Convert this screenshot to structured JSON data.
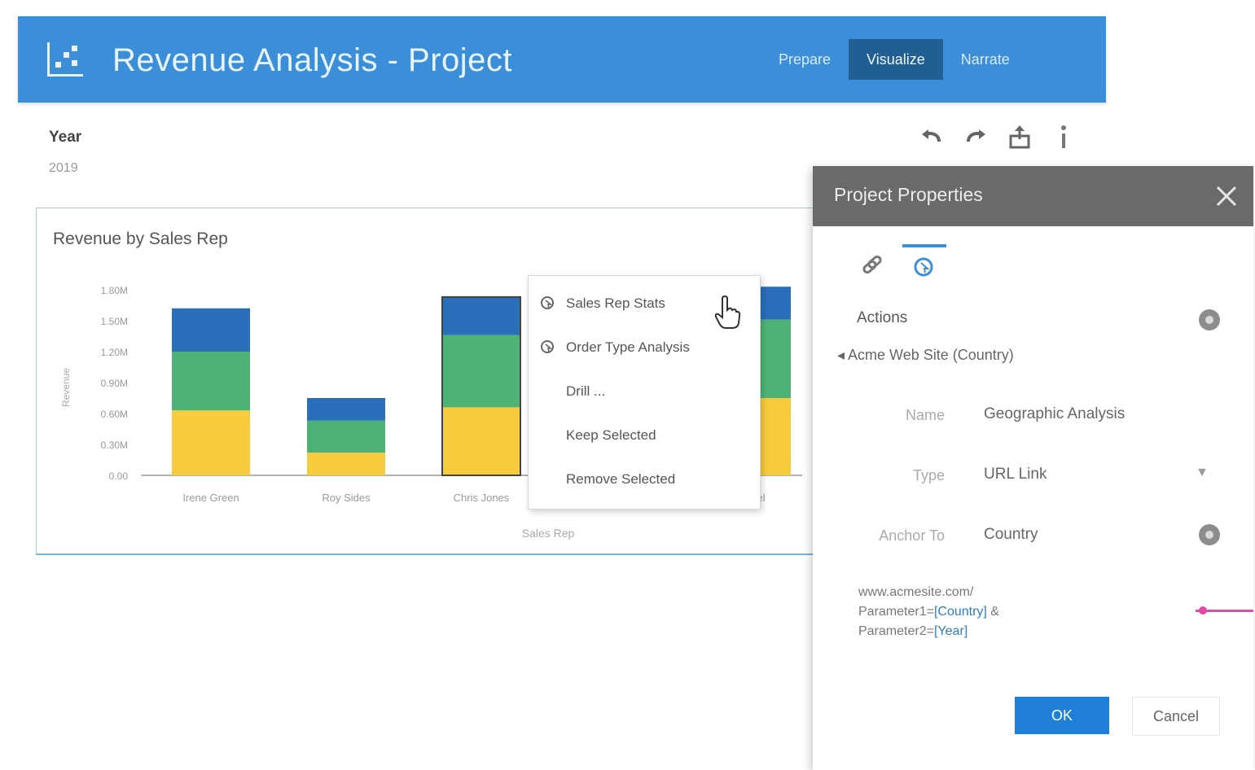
{
  "header": {
    "app_icon": "dashboard-icon",
    "title": "Revenue Analysis - Project",
    "tabs": [
      {
        "label": "Prepare",
        "active": false
      },
      {
        "label": "Visualize",
        "active": true
      },
      {
        "label": "Narrate",
        "active": false
      }
    ],
    "background_color": "#3a8fd8"
  },
  "filter": {
    "label": "Year",
    "value": "2019"
  },
  "toolbar": {
    "icons": [
      "undo-icon",
      "redo-icon",
      "export-icon",
      "more-icon"
    ]
  },
  "chart_data": {
    "type": "bar",
    "stacked": true,
    "title": "Revenue by Sales Rep",
    "xlabel": "Sales Rep",
    "ylabel": "Revenue",
    "categories": [
      "Irene Green",
      "Roy Sides",
      "Chris Jones",
      "",
      "Rosel"
    ],
    "y_ticks": [
      "0.00",
      "0.30M",
      "0.60M",
      "0.90M",
      "1.20M",
      "1.50M",
      "1.80M"
    ],
    "ylim": [
      0,
      1.8
    ],
    "series": [
      {
        "color": "#f6cb3d",
        "values": [
          0.63,
          0.22,
          0.66,
          0,
          0.75
        ]
      },
      {
        "color": "#4db276",
        "values": [
          0.57,
          0.31,
          0.7,
          0,
          0.76
        ]
      },
      {
        "color": "#2a6fb9",
        "values": [
          0.42,
          0.22,
          0.37,
          0,
          0.32
        ]
      }
    ],
    "grid": false,
    "legend": "none"
  },
  "context_menu": {
    "items": [
      {
        "label": "Sales Rep Stats",
        "icon": "action-link-icon"
      },
      {
        "label": "Order Type Analysis",
        "icon": "action-link-icon"
      },
      {
        "label": "Drill ...",
        "icon": ""
      },
      {
        "label": "Keep Selected",
        "icon": ""
      },
      {
        "label": "Remove Selected",
        "icon": ""
      }
    ]
  },
  "dialog": {
    "title": "Project Properties",
    "tabs": [
      {
        "icon": "link-icon",
        "active": false
      },
      {
        "icon": "action-icon",
        "active": true
      }
    ],
    "section_title": "Actions",
    "action_item": "Acme Web Site (Country)",
    "fields": [
      {
        "label": "Name",
        "value": "Geographic Analysis"
      },
      {
        "label": "Type",
        "value": "URL Link"
      },
      {
        "label": "Anchor To",
        "value": "Country"
      }
    ],
    "url": {
      "prefix": "www.acmesite.com/",
      "line2_pre": "Parameter1=",
      "param1": "[Country]",
      "line2_post": " & ",
      "line3_pre": "Parameter2=",
      "param2": "[Year]"
    },
    "ok_label": "OK",
    "cancel_label": "Cancel"
  }
}
